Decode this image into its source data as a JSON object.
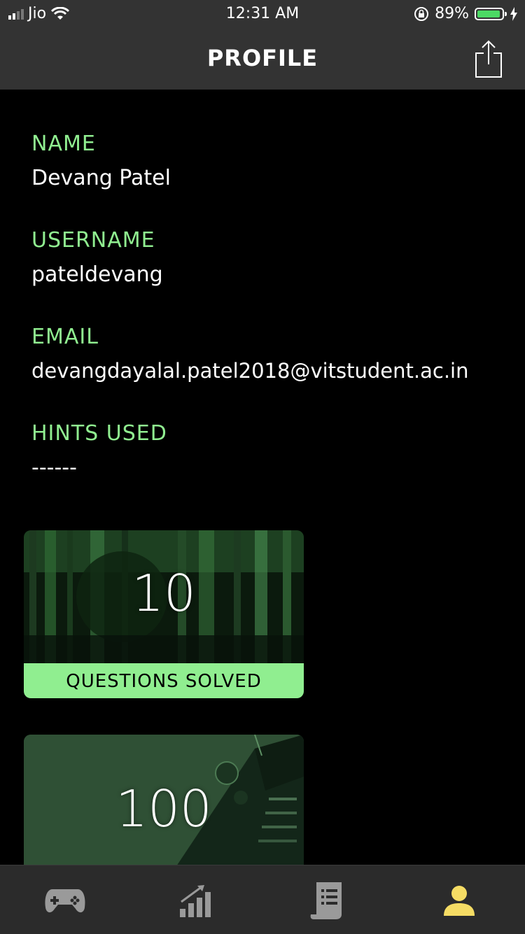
{
  "status_bar": {
    "carrier": "Jio",
    "time": "12:31 AM",
    "battery_percent": "89%",
    "signal_bars": 2,
    "battery_level": 0.89,
    "icons": [
      "signal-icon",
      "wifi-icon",
      "orientation-lock-icon",
      "battery-icon",
      "charging-icon"
    ]
  },
  "header": {
    "title": "PROFILE",
    "share_icon": "share-icon"
  },
  "profile": {
    "name_label": "NAME",
    "name_value": "Devang Patel",
    "username_label": "USERNAME",
    "username_value": "pateldevang",
    "email_label": "EMAIL",
    "email_value": "devangdayalal.patel2018@vitstudent.ac.in",
    "hints_label": "HINTS USED",
    "hints_value": "------"
  },
  "cards": [
    {
      "value": "10",
      "caption": "QUESTIONS SOLVED"
    },
    {
      "value": "100"
    }
  ],
  "tab_bar": {
    "tabs": [
      {
        "icon": "gamepad-icon",
        "active": false
      },
      {
        "icon": "leaderboard-icon",
        "active": false
      },
      {
        "icon": "rules-icon",
        "active": false
      },
      {
        "icon": "profile-icon",
        "active": true
      }
    ],
    "active_color": "#f5dc64",
    "inactive_color": "#9a9a9a"
  },
  "colors": {
    "accent": "#90ee90",
    "header_bg": "#333333",
    "background": "#000000"
  }
}
